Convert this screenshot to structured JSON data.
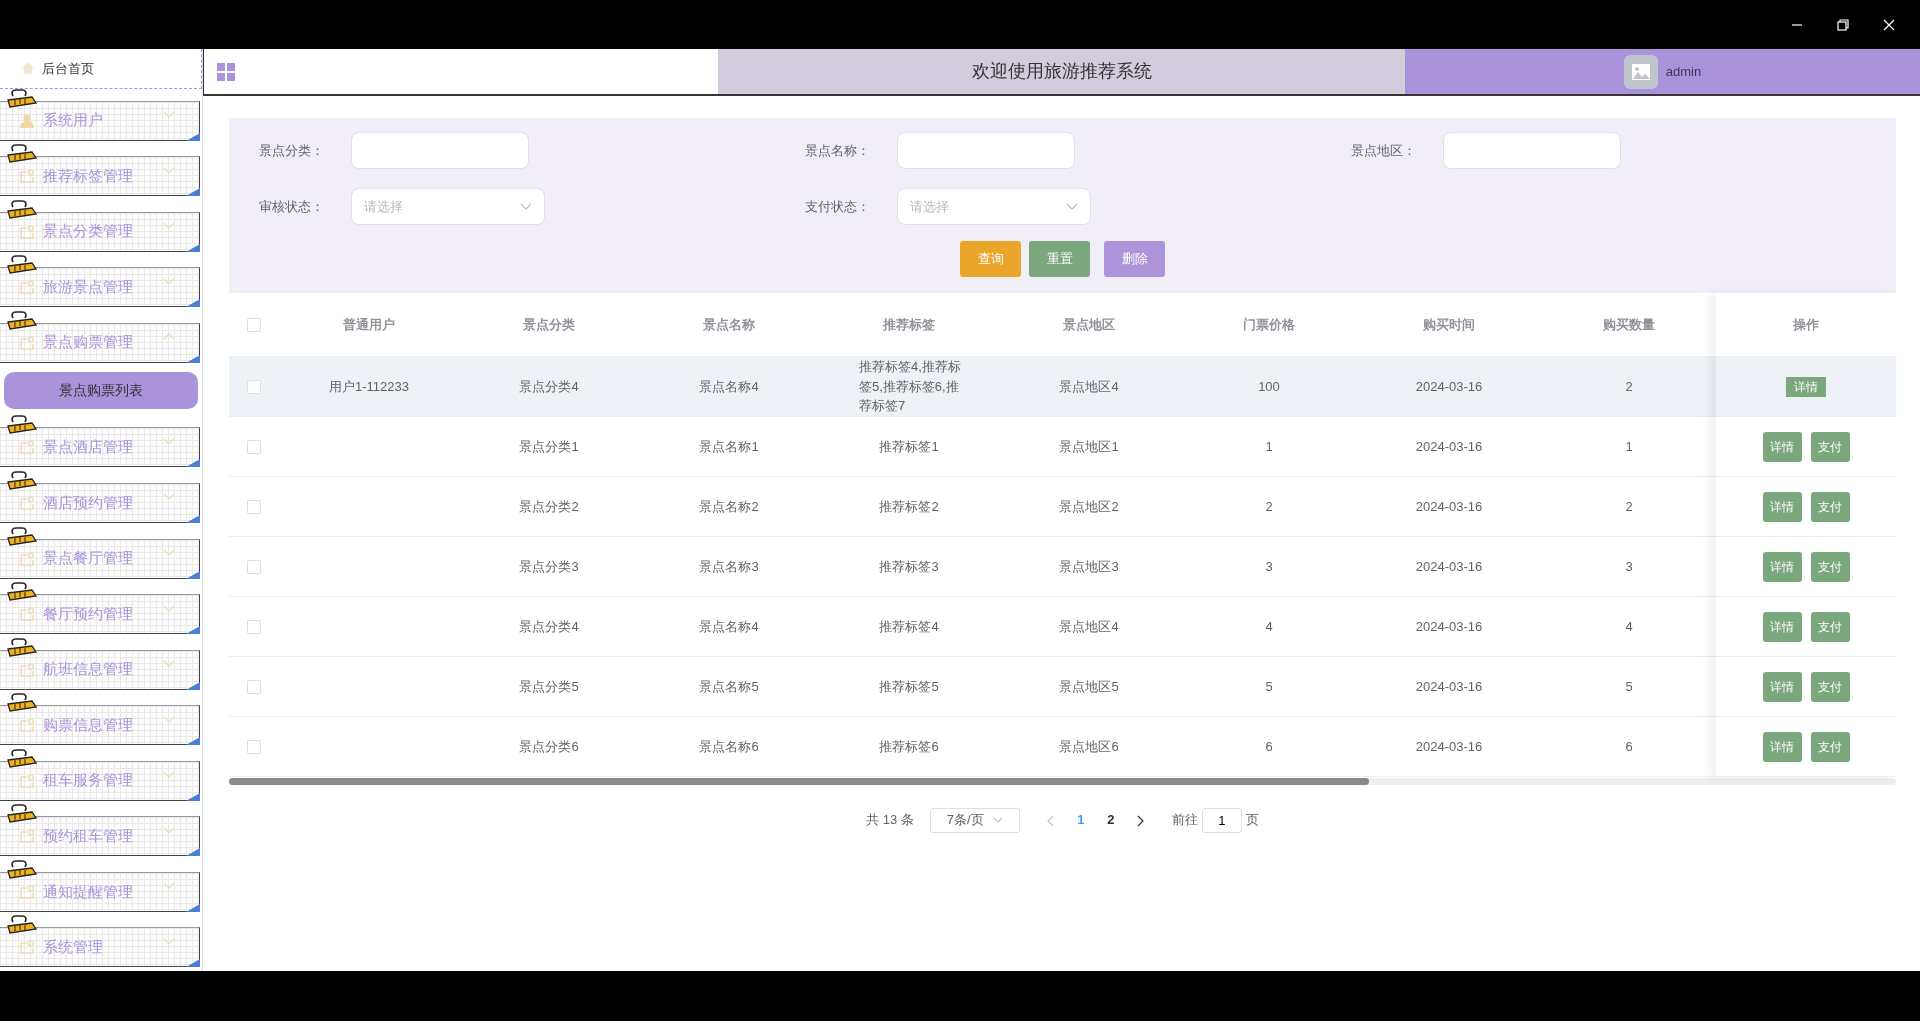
{
  "header": {
    "home_label": "后台首页",
    "title": "欢迎使用旅游推荐系统",
    "user": "admin"
  },
  "sidebar": {
    "items": [
      {
        "label": "系统用户",
        "expanded": false
      },
      {
        "label": "推荐标签管理",
        "expanded": false
      },
      {
        "label": "景点分类管理",
        "expanded": false
      },
      {
        "label": "旅游景点管理",
        "expanded": false
      },
      {
        "label": "景点购票管理",
        "expanded": true,
        "children": [
          {
            "label": "景点购票列表",
            "selected": true
          }
        ]
      },
      {
        "label": "景点酒店管理",
        "expanded": false
      },
      {
        "label": "酒店预约管理",
        "expanded": false
      },
      {
        "label": "景点餐厅管理",
        "expanded": false
      },
      {
        "label": "餐厅预约管理",
        "expanded": false
      },
      {
        "label": "航班信息管理",
        "expanded": false
      },
      {
        "label": "购票信息管理",
        "expanded": false
      },
      {
        "label": "租车服务管理",
        "expanded": false
      },
      {
        "label": "预约租车管理",
        "expanded": false
      },
      {
        "label": "通知提醒管理",
        "expanded": false
      },
      {
        "label": "系统管理",
        "expanded": false
      }
    ]
  },
  "search": {
    "fields": [
      {
        "label": "景点分类：",
        "kind": "text"
      },
      {
        "label": "景点名称：",
        "kind": "text"
      },
      {
        "label": "景点地区：",
        "kind": "text"
      },
      {
        "label": "审核状态：",
        "kind": "select",
        "placeholder": "请选择"
      },
      {
        "label": "支付状态：",
        "kind": "select",
        "placeholder": "请选择"
      }
    ],
    "buttons": [
      {
        "label": "查询",
        "color": "#eaa52b"
      },
      {
        "label": "重置",
        "color": "#7ba77c"
      },
      {
        "label": "删除",
        "color": "#ab94d9"
      }
    ]
  },
  "table": {
    "select_all_checked": false,
    "columns": [
      "普通用户",
      "景点分类",
      "景点名称",
      "推荐标签",
      "景点地区",
      "门票价格",
      "购买时间",
      "购买数量"
    ],
    "actions_label": "操作",
    "rows": [
      {
        "checked": false,
        "highlighted": true,
        "cells": [
          "用户1-112233",
          "景点分类4",
          "景点名称4",
          "推荐标签4,推荐标签5,推荐标签6,推荐标签7",
          "景点地区4",
          "100",
          "2024-03-16",
          "2"
        ],
        "actions": [
          "详情"
        ]
      },
      {
        "checked": false,
        "highlighted": false,
        "cells": [
          null,
          "景点分类1",
          "景点名称1",
          "推荐标签1",
          "景点地区1",
          "1",
          "2024-03-16",
          "1"
        ],
        "actions": [
          "详情",
          "支付"
        ]
      },
      {
        "checked": false,
        "highlighted": false,
        "cells": [
          null,
          "景点分类2",
          "景点名称2",
          "推荐标签2",
          "景点地区2",
          "2",
          "2024-03-16",
          "2"
        ],
        "actions": [
          "详情",
          "支付"
        ]
      },
      {
        "checked": false,
        "highlighted": false,
        "cells": [
          null,
          "景点分类3",
          "景点名称3",
          "推荐标签3",
          "景点地区3",
          "3",
          "2024-03-16",
          "3"
        ],
        "actions": [
          "详情",
          "支付"
        ]
      },
      {
        "checked": false,
        "highlighted": false,
        "cells": [
          null,
          "景点分类4",
          "景点名称4",
          "推荐标签4",
          "景点地区4",
          "4",
          "2024-03-16",
          "4"
        ],
        "actions": [
          "详情",
          "支付"
        ]
      },
      {
        "checked": false,
        "highlighted": false,
        "cells": [
          null,
          "景点分类5",
          "景点名称5",
          "推荐标签5",
          "景点地区5",
          "5",
          "2024-03-16",
          "5"
        ],
        "actions": [
          "详情",
          "支付"
        ]
      },
      {
        "checked": false,
        "highlighted": false,
        "cells": [
          null,
          "景点分类6",
          "景点名称6",
          "推荐标签6",
          "景点地区6",
          "6",
          "2024-03-16",
          "6"
        ],
        "actions": [
          "详情",
          "支付"
        ]
      }
    ]
  },
  "pagination": {
    "total": "共 13 条",
    "page_size": "7条/页",
    "pages": [
      {
        "label": "1",
        "selected": true
      },
      {
        "label": "2",
        "selected": false
      }
    ],
    "goto_label": "前往",
    "goto_value": "1",
    "goto_suffix": "页"
  }
}
